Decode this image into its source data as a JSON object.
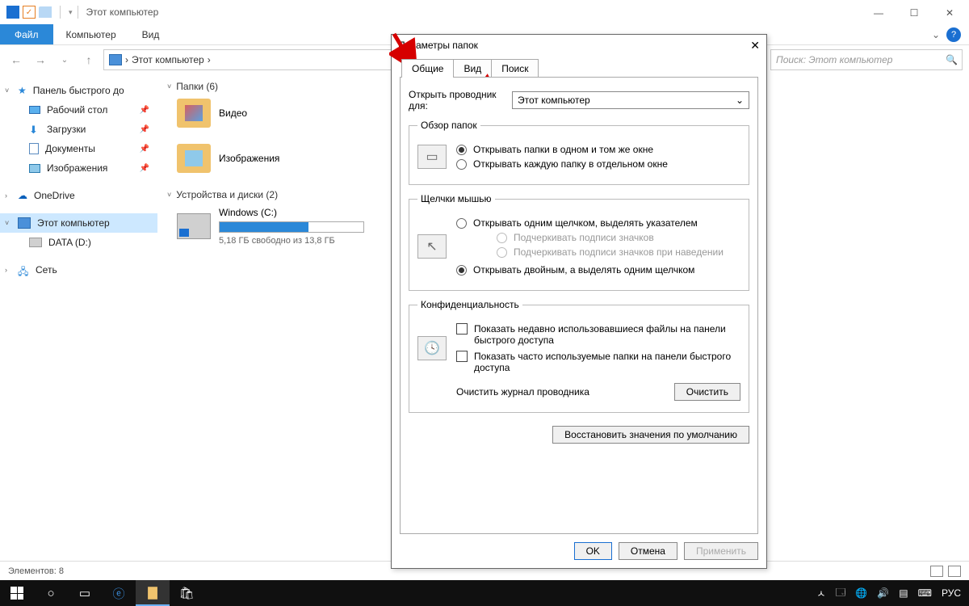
{
  "titlebar": {
    "title": "Этот компьютер"
  },
  "winbtns": {
    "min": "—",
    "max": "☐",
    "close": "✕"
  },
  "ribbon": {
    "file": "Файл",
    "computer": "Компьютер",
    "view": "Вид",
    "help": "?",
    "chev": "⌄"
  },
  "addr": {
    "back": "←",
    "fwd": "→",
    "hist": "⌄",
    "up": "↑",
    "crumb_root_sep": "›",
    "crumb1": "Этот компьютер",
    "crumb_sep": "›",
    "refresh": "⟳"
  },
  "search": {
    "placeholder": "Поиск: Этот компьютер",
    "icon": "🔍"
  },
  "sidebar": {
    "quick": "Панель быстрого до",
    "desktop": "Рабочий стол",
    "downloads": "Загрузки",
    "documents": "Документы",
    "pictures": "Изображения",
    "onedrive": "OneDrive",
    "thispc": "Этот компьютер",
    "data": "DATA (D:)",
    "network": "Сеть"
  },
  "content": {
    "group_folders": "Папки (6)",
    "item_video": "Видео",
    "item_pictures": "Изображения",
    "group_drives": "Устройства и диски (2)",
    "drive_c_name": "Windows (C:)",
    "drive_c_sub": "5,18 ГБ свободно из 13,8 ГБ"
  },
  "status": {
    "count": "Элементов: 8"
  },
  "dialog": {
    "title": "Параметры папок",
    "close": "✕",
    "tab_general": "Общие",
    "tab_view": "Вид",
    "tab_search": "Поиск",
    "open_explorer_for": "Открыть проводник для:",
    "combo_value": "Этот компьютер",
    "combo_caret": "⌄",
    "fs_browse": "Обзор папок",
    "r_same_window": "Открывать папки в одном и том же окне",
    "r_new_window": "Открывать каждую папку в отдельном окне",
    "fs_clicks": "Щелчки мышью",
    "r_single": "Открывать одним щелчком, выделять указателем",
    "r_underline_icon": "Подчеркивать подписи значков",
    "r_underline_hover": "Подчеркивать подписи значков при наведении",
    "r_double": "Открывать двойным, а выделять одним щелчком",
    "fs_privacy": "Конфиденциальность",
    "c_recent_files": "Показать недавно использовавшиеся файлы на панели быстрого доступа",
    "c_freq_folders": "Показать часто используемые папки на панели быстрого доступа",
    "clear_label": "Очистить журнал проводника",
    "btn_clear": "Очистить",
    "btn_defaults": "Восстановить значения по умолчанию",
    "btn_ok": "OK",
    "btn_cancel": "Отмена",
    "btn_apply": "Применить"
  },
  "taskbar": {
    "tray_up": "ㅅ",
    "lang": "РУС"
  }
}
